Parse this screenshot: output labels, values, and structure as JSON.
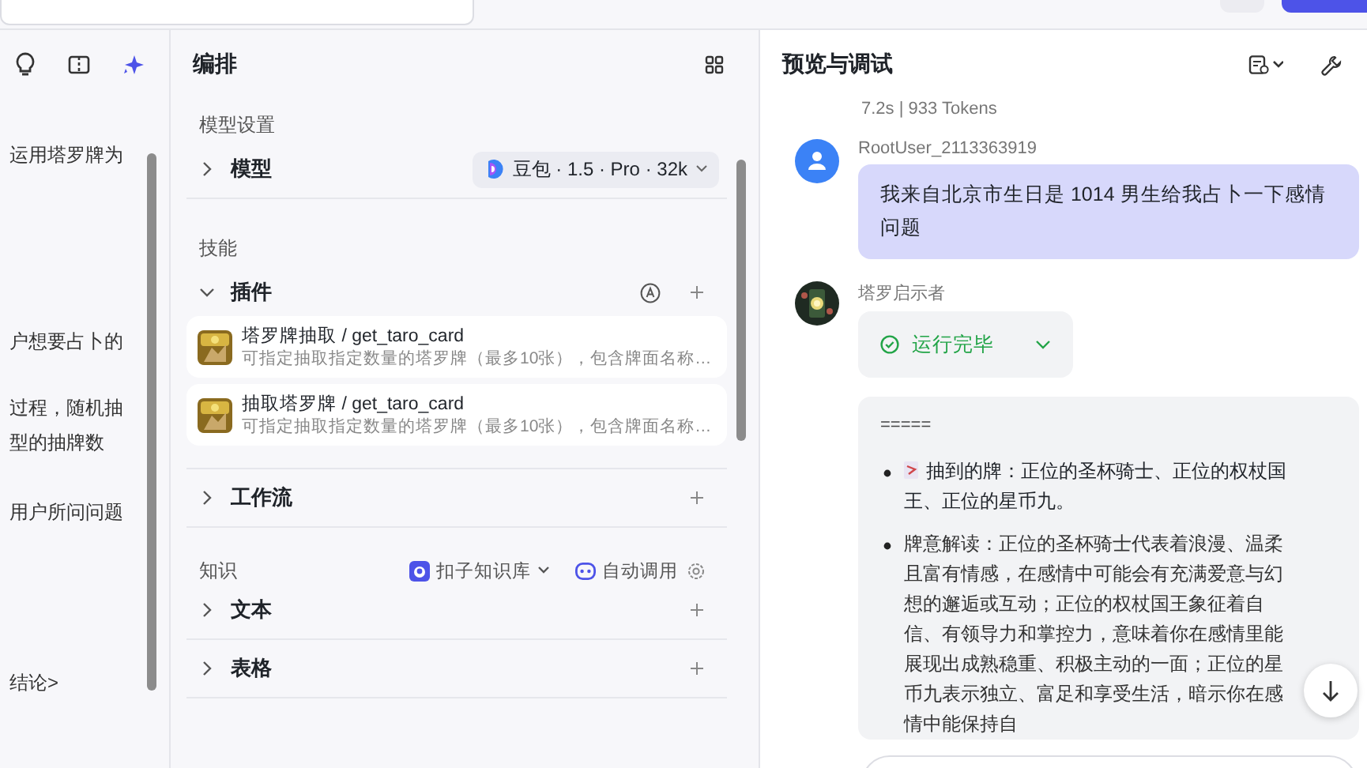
{
  "left_panel": {
    "lines": [
      "运用塔罗牌为",
      "户想要占卜的",
      "过程，随机抽",
      "型的抽牌数",
      "用户所问问题",
      "结论>"
    ]
  },
  "arrange": {
    "title": "编排",
    "model_section": {
      "label": "模型设置",
      "row": {
        "label": "模型",
        "expanded": false,
        "model": "豆包 · 1.5 · Pro · 32k"
      }
    },
    "skills_section": {
      "label": "技能",
      "plugins": {
        "label": "插件",
        "expanded": true,
        "items": [
          {
            "name": "塔罗牌抽取 / get_taro_card",
            "desc": "可指定抽取指定数量的塔罗牌（最多10张），包含牌面名称…"
          },
          {
            "name": "抽取塔罗牌 / get_taro_card",
            "desc": "可指定抽取指定数量的塔罗牌（最多10张），包含牌面名称…"
          }
        ]
      },
      "workflow": {
        "label": "工作流",
        "expanded": false
      }
    },
    "knowledge_section": {
      "label": "知识",
      "source": "扣子知识库",
      "mode": "自动调用",
      "rows": [
        {
          "label": "文本",
          "expanded": false
        },
        {
          "label": "表格",
          "expanded": false
        }
      ]
    }
  },
  "preview": {
    "title": "预览与调试",
    "meta": "7.2s | 933 Tokens",
    "user_message": {
      "author": "RootUser_2113363919",
      "text": "我来自北京市生日是 1014 男生给我占卜一下感情问题"
    },
    "bot_message": {
      "author": "塔罗启示者",
      "status": "运行完毕",
      "divider": "=====",
      "bullets": [
        {
          "text": "抽到的牌：正位的圣杯骑士、正位的权杖国王、正位的星币九。",
          "card_icon": true
        },
        {
          "text": "牌意解读：正位的圣杯骑士代表着浪漫、温柔且富有情感，在感情中可能会有充满爱意与幻想的邂逅或互动；正位的权杖国王象征着自信、有领导力和掌控力，意味着你在感情里能展现出成熟稳重、积极主动的一面；正位的星币九表示独立、富足和享受生活，暗示你在感情中能保持自",
          "card_icon": false
        }
      ]
    }
  }
}
